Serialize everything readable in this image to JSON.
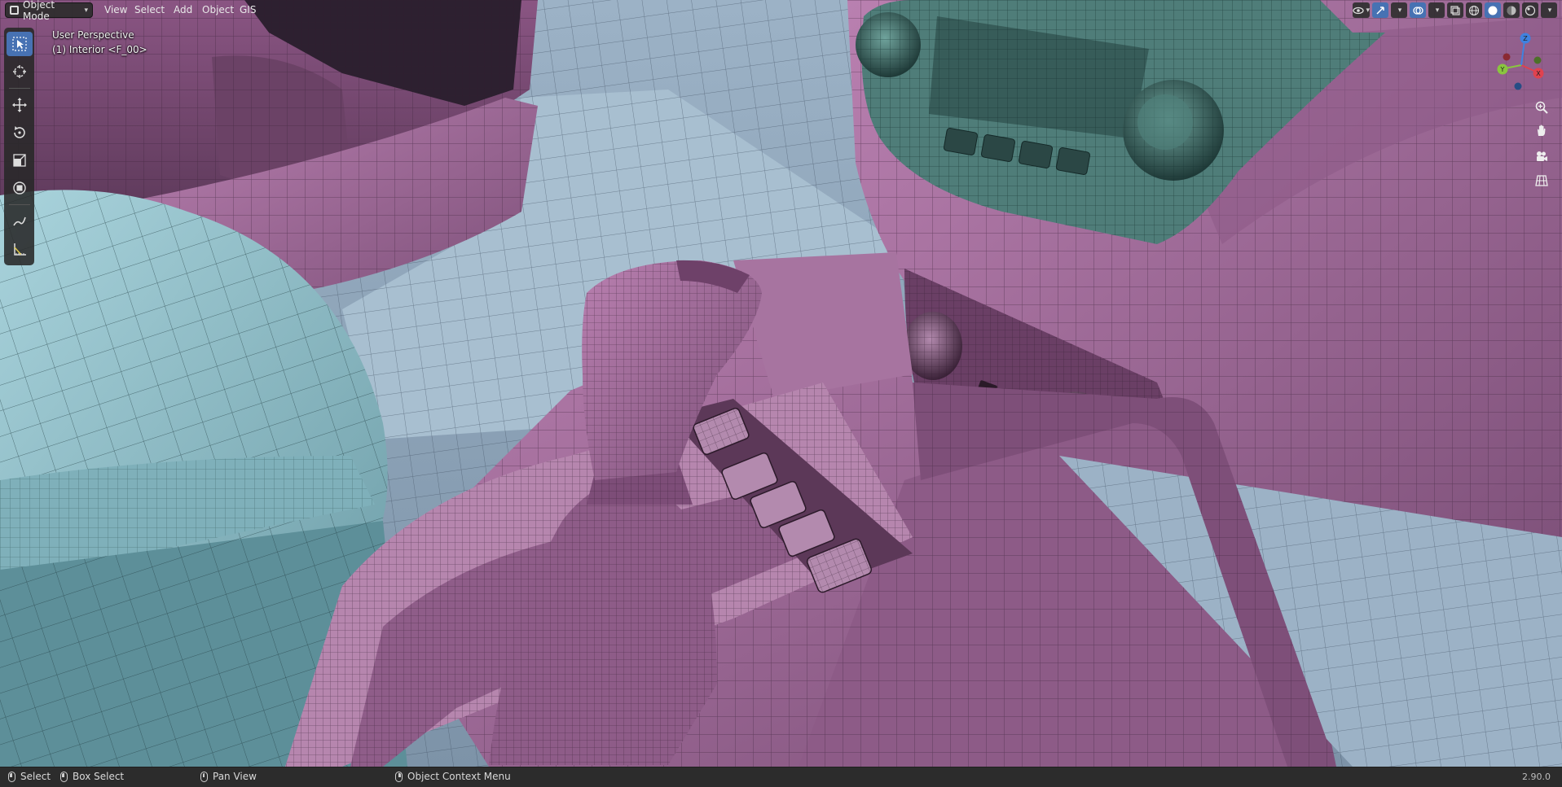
{
  "header": {
    "mode": "Object Mode",
    "menus": [
      "View",
      "Select",
      "Add",
      "Object",
      "GIS"
    ]
  },
  "viewport": {
    "perspective": "User Perspective",
    "collection": "(1) Interior <F_00>"
  },
  "toolbar": {
    "tools": [
      "select-box",
      "cursor",
      "move",
      "rotate",
      "scale",
      "transform",
      "annotate",
      "measure"
    ]
  },
  "gizmo": {
    "axes": [
      "X",
      "Y",
      "Z"
    ]
  },
  "statusbar": {
    "select": "Select",
    "box_select": "Box Select",
    "pan_view": "Pan View",
    "context_menu": "Object Context Menu",
    "version": "2.90.0"
  },
  "colors": {
    "accent": "#4772b3",
    "mesh_pink": "#a9739f",
    "mesh_teal": "#9cc6cf",
    "floor": "#8fa5bb",
    "axis_x": "#e0424f",
    "axis_y": "#8ac53f",
    "axis_z": "#3f82e0"
  }
}
